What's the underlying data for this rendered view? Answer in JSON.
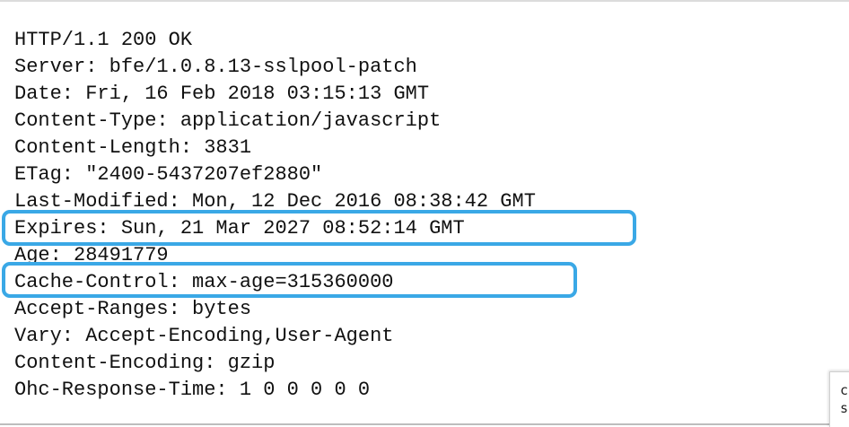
{
  "response": {
    "lines": [
      "HTTP/1.1 200 OK",
      "Server: bfe/1.0.8.13-sslpool-patch",
      "Date: Fri, 16 Feb 2018 03:15:13 GMT",
      "Content-Type: application/javascript",
      "Content-Length: 3831",
      "ETag: \"2400-5437207ef2880\"",
      "Last-Modified: Mon, 12 Dec 2016 08:38:42 GMT",
      "Expires: Sun, 21 Mar 2027 08:52:14 GMT",
      "Age: 28491779",
      "Cache-Control: max-age=315360000",
      "Accept-Ranges: bytes",
      "Vary: Accept-Encoding,User-Agent",
      "Content-Encoding: gzip",
      "Ohc-Response-Time: 1 0 0 0 0 0"
    ]
  },
  "highlight_color": "#3aa8e6",
  "side_popup": {
    "line1": "c",
    "line2": "s"
  }
}
